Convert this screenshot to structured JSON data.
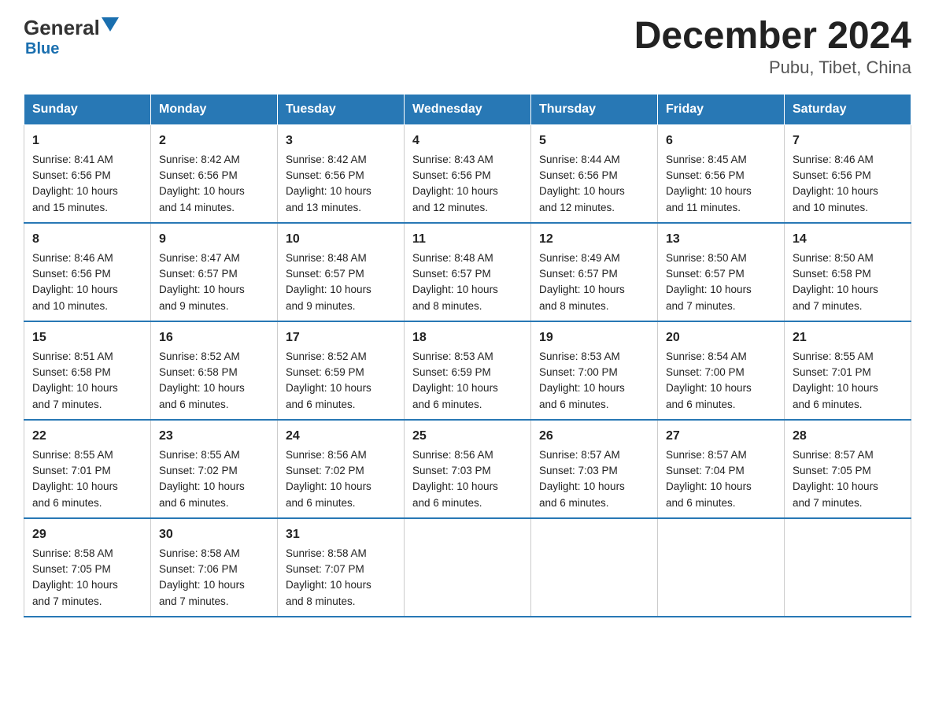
{
  "header": {
    "logo_general": "General",
    "logo_blue": "Blue",
    "title": "December 2024",
    "subtitle": "Pubu, Tibet, China"
  },
  "calendar": {
    "days": [
      "Sunday",
      "Monday",
      "Tuesday",
      "Wednesday",
      "Thursday",
      "Friday",
      "Saturday"
    ],
    "weeks": [
      [
        {
          "day": "1",
          "sunrise": "8:41 AM",
          "sunset": "6:56 PM",
          "daylight": "10 hours and 15 minutes."
        },
        {
          "day": "2",
          "sunrise": "8:42 AM",
          "sunset": "6:56 PM",
          "daylight": "10 hours and 14 minutes."
        },
        {
          "day": "3",
          "sunrise": "8:42 AM",
          "sunset": "6:56 PM",
          "daylight": "10 hours and 13 minutes."
        },
        {
          "day": "4",
          "sunrise": "8:43 AM",
          "sunset": "6:56 PM",
          "daylight": "10 hours and 12 minutes."
        },
        {
          "day": "5",
          "sunrise": "8:44 AM",
          "sunset": "6:56 PM",
          "daylight": "10 hours and 12 minutes."
        },
        {
          "day": "6",
          "sunrise": "8:45 AM",
          "sunset": "6:56 PM",
          "daylight": "10 hours and 11 minutes."
        },
        {
          "day": "7",
          "sunrise": "8:46 AM",
          "sunset": "6:56 PM",
          "daylight": "10 hours and 10 minutes."
        }
      ],
      [
        {
          "day": "8",
          "sunrise": "8:46 AM",
          "sunset": "6:56 PM",
          "daylight": "10 hours and 10 minutes."
        },
        {
          "day": "9",
          "sunrise": "8:47 AM",
          "sunset": "6:57 PM",
          "daylight": "10 hours and 9 minutes."
        },
        {
          "day": "10",
          "sunrise": "8:48 AM",
          "sunset": "6:57 PM",
          "daylight": "10 hours and 9 minutes."
        },
        {
          "day": "11",
          "sunrise": "8:48 AM",
          "sunset": "6:57 PM",
          "daylight": "10 hours and 8 minutes."
        },
        {
          "day": "12",
          "sunrise": "8:49 AM",
          "sunset": "6:57 PM",
          "daylight": "10 hours and 8 minutes."
        },
        {
          "day": "13",
          "sunrise": "8:50 AM",
          "sunset": "6:57 PM",
          "daylight": "10 hours and 7 minutes."
        },
        {
          "day": "14",
          "sunrise": "8:50 AM",
          "sunset": "6:58 PM",
          "daylight": "10 hours and 7 minutes."
        }
      ],
      [
        {
          "day": "15",
          "sunrise": "8:51 AM",
          "sunset": "6:58 PM",
          "daylight": "10 hours and 7 minutes."
        },
        {
          "day": "16",
          "sunrise": "8:52 AM",
          "sunset": "6:58 PM",
          "daylight": "10 hours and 6 minutes."
        },
        {
          "day": "17",
          "sunrise": "8:52 AM",
          "sunset": "6:59 PM",
          "daylight": "10 hours and 6 minutes."
        },
        {
          "day": "18",
          "sunrise": "8:53 AM",
          "sunset": "6:59 PM",
          "daylight": "10 hours and 6 minutes."
        },
        {
          "day": "19",
          "sunrise": "8:53 AM",
          "sunset": "7:00 PM",
          "daylight": "10 hours and 6 minutes."
        },
        {
          "day": "20",
          "sunrise": "8:54 AM",
          "sunset": "7:00 PM",
          "daylight": "10 hours and 6 minutes."
        },
        {
          "day": "21",
          "sunrise": "8:55 AM",
          "sunset": "7:01 PM",
          "daylight": "10 hours and 6 minutes."
        }
      ],
      [
        {
          "day": "22",
          "sunrise": "8:55 AM",
          "sunset": "7:01 PM",
          "daylight": "10 hours and 6 minutes."
        },
        {
          "day": "23",
          "sunrise": "8:55 AM",
          "sunset": "7:02 PM",
          "daylight": "10 hours and 6 minutes."
        },
        {
          "day": "24",
          "sunrise": "8:56 AM",
          "sunset": "7:02 PM",
          "daylight": "10 hours and 6 minutes."
        },
        {
          "day": "25",
          "sunrise": "8:56 AM",
          "sunset": "7:03 PM",
          "daylight": "10 hours and 6 minutes."
        },
        {
          "day": "26",
          "sunrise": "8:57 AM",
          "sunset": "7:03 PM",
          "daylight": "10 hours and 6 minutes."
        },
        {
          "day": "27",
          "sunrise": "8:57 AM",
          "sunset": "7:04 PM",
          "daylight": "10 hours and 6 minutes."
        },
        {
          "day": "28",
          "sunrise": "8:57 AM",
          "sunset": "7:05 PM",
          "daylight": "10 hours and 7 minutes."
        }
      ],
      [
        {
          "day": "29",
          "sunrise": "8:58 AM",
          "sunset": "7:05 PM",
          "daylight": "10 hours and 7 minutes."
        },
        {
          "day": "30",
          "sunrise": "8:58 AM",
          "sunset": "7:06 PM",
          "daylight": "10 hours and 7 minutes."
        },
        {
          "day": "31",
          "sunrise": "8:58 AM",
          "sunset": "7:07 PM",
          "daylight": "10 hours and 8 minutes."
        },
        null,
        null,
        null,
        null
      ]
    ],
    "sunrise_label": "Sunrise:",
    "sunset_label": "Sunset:",
    "daylight_label": "Daylight:"
  }
}
